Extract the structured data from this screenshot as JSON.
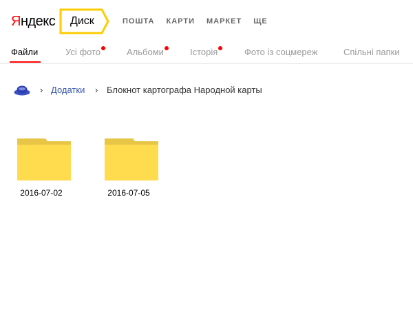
{
  "header": {
    "logo": {
      "first_letter": "Я",
      "rest": "ндекс"
    },
    "service": "Диск",
    "nav": [
      "ПОШТА",
      "КАРТИ",
      "МАРКЕТ",
      "ЩЕ"
    ]
  },
  "tabs": [
    {
      "label": "Файли",
      "active": true,
      "has_dot": false
    },
    {
      "label": "Усі фото",
      "active": false,
      "has_dot": true
    },
    {
      "label": "Альбоми",
      "active": false,
      "has_dot": true
    },
    {
      "label": "Історія",
      "active": false,
      "has_dot": true
    },
    {
      "label": "Фото із соцмереж",
      "active": false,
      "has_dot": false
    },
    {
      "label": "Спільні папки",
      "active": false,
      "has_dot": false
    }
  ],
  "breadcrumb": {
    "home_icon": "disk-home-icon",
    "separator": "›",
    "link": "Додатки",
    "current": "Блокнот картографа Народной карты"
  },
  "folders": [
    {
      "name": "2016-07-02",
      "icon": "folder-icon"
    },
    {
      "name": "2016-07-05",
      "icon": "folder-icon"
    }
  ],
  "colors": {
    "accent": "#ff0000",
    "badge_border": "#ffcc00",
    "folder": "#ffdb4d",
    "folder_tab": "#e6c547",
    "link": "#3355aa"
  }
}
